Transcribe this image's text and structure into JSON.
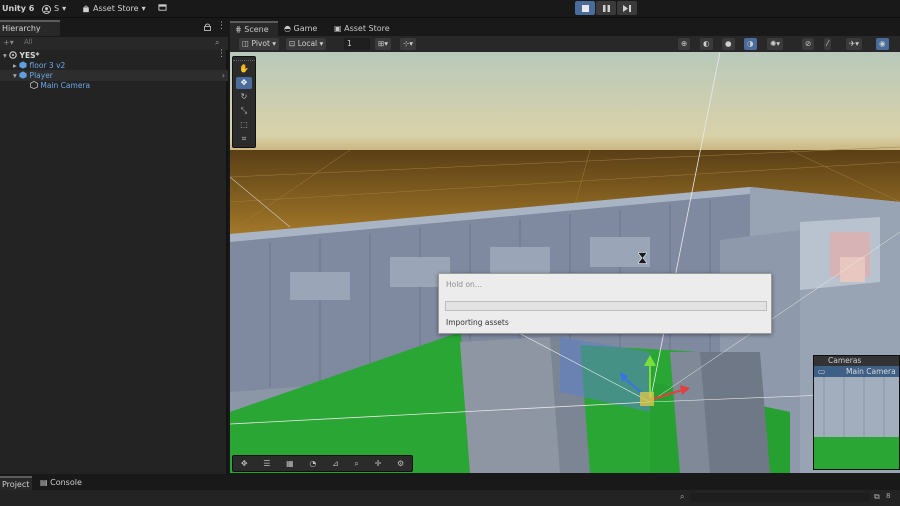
{
  "topbar": {
    "app_label": "Unity 6",
    "account_label": "S",
    "asset_store_label": "Asset Store",
    "play_active": true
  },
  "hierarchy": {
    "tab_label": "Hierarchy",
    "search_placeholder": "All",
    "rows": [
      {
        "label": "YES*",
        "style": "scene"
      },
      {
        "label": "floor 3 v2",
        "style": "prefab"
      },
      {
        "label": "Player",
        "style": "prefab-selected"
      },
      {
        "label": "Main Camera",
        "style": "prefab"
      }
    ]
  },
  "scene": {
    "tabs": [
      {
        "label": "Scene",
        "selected": true
      },
      {
        "label": "Game",
        "selected": false
      },
      {
        "label": "Asset Store",
        "selected": false
      }
    ],
    "toolbar": {
      "pivot_label": "Pivot",
      "local_label": "Local",
      "grid_snap_value": "1"
    }
  },
  "dialog": {
    "title": "Hold on...",
    "message": "Importing assets",
    "progress": 0
  },
  "camera_overlay": {
    "header": "Cameras",
    "selected_camera": "Main Camera"
  },
  "bottom": {
    "tabs": [
      {
        "label": "Project",
        "selected": true
      },
      {
        "label": "Console",
        "selected": false
      }
    ],
    "badge": "8"
  },
  "colors": {
    "accent": "#4a6c9c",
    "prefab_blue": "#6aa8e8",
    "floor_green": "#2aa634",
    "sky_top": "#b9c9bb",
    "horizon": "#6b4b1e"
  }
}
